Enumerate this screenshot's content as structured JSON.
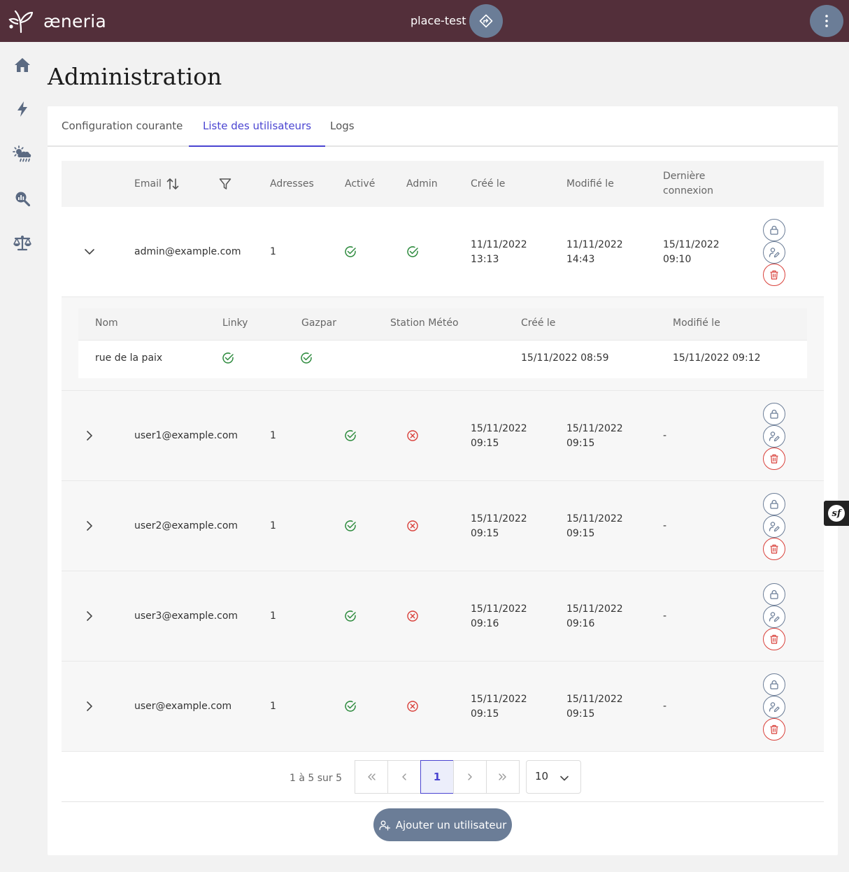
{
  "app": {
    "name": "æneria",
    "place": "place-test"
  },
  "sidebar": {
    "items": [
      "home-icon",
      "lightning-icon",
      "weather-icon",
      "analysis-icon",
      "balance-icon"
    ]
  },
  "page": {
    "title": "Administration"
  },
  "tabs": [
    {
      "label": "Configuration courante"
    },
    {
      "label": "Liste des utilisateurs",
      "active": true
    },
    {
      "label": "Logs"
    }
  ],
  "table": {
    "headers": {
      "email": "Email",
      "addresses": "Adresses",
      "active": "Activé",
      "admin": "Admin",
      "created": "Créé le",
      "modified": "Modifié le",
      "last_login_1": "Dernière",
      "last_login_2": "connexion"
    },
    "rows": [
      {
        "email": "admin@example.com",
        "addresses": "1",
        "active": true,
        "admin": true,
        "created_date": "11/11/2022",
        "created_time": "13:13",
        "modified_date": "11/11/2022",
        "modified_time": "14:43",
        "last_date": "15/11/2022",
        "last_time": "09:10",
        "expanded": true
      },
      {
        "email": "user1@example.com",
        "addresses": "1",
        "active": true,
        "admin": false,
        "created_date": "15/11/2022",
        "created_time": "09:15",
        "modified_date": "15/11/2022",
        "modified_time": "09:15",
        "last": "-"
      },
      {
        "email": "user2@example.com",
        "addresses": "1",
        "active": true,
        "admin": false,
        "created_date": "15/11/2022",
        "created_time": "09:15",
        "modified_date": "15/11/2022",
        "modified_time": "09:15",
        "last": "-"
      },
      {
        "email": "user3@example.com",
        "addresses": "1",
        "active": true,
        "admin": false,
        "created_date": "15/11/2022",
        "created_time": "09:16",
        "modified_date": "15/11/2022",
        "modified_time": "09:16",
        "last": "-"
      },
      {
        "email": "user@example.com",
        "addresses": "1",
        "active": true,
        "admin": false,
        "created_date": "15/11/2022",
        "created_time": "09:15",
        "modified_date": "15/11/2022",
        "modified_time": "09:15",
        "last": "-"
      }
    ]
  },
  "subtable": {
    "headers": {
      "name": "Nom",
      "linky": "Linky",
      "gazpar": "Gazpar",
      "meteo": "Station Météo",
      "created": "Créé le",
      "modified": "Modifié le"
    },
    "row": {
      "name": "rue de la paix",
      "linky": true,
      "gazpar": true,
      "created": "15/11/2022 08:59",
      "modified": "15/11/2022 09:12"
    }
  },
  "pagination": {
    "info": "1 à 5 sur 5",
    "current_page": "1",
    "page_size": "10"
  },
  "actions": {
    "add_user": "Ajouter un utilisateur"
  },
  "colors": {
    "topbar": "#532f3a",
    "accent": "#4a44d1",
    "button": "#6b7d97",
    "success": "#2e8b3e",
    "danger": "#d9403a"
  }
}
